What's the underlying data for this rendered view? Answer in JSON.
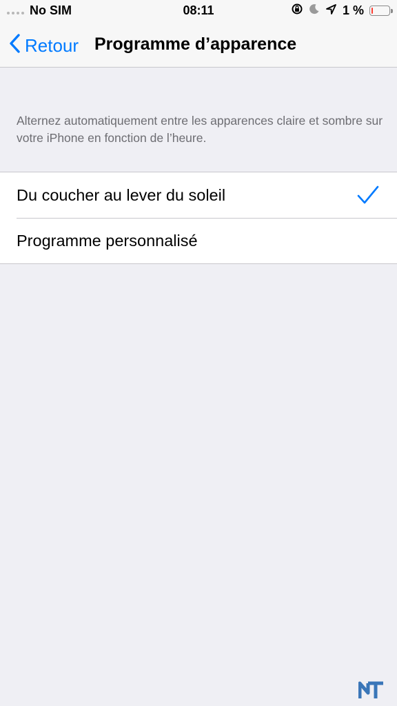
{
  "status_bar": {
    "carrier": "No SIM",
    "time": "08:11",
    "battery_percent": "1 %",
    "battery_level": 0.01,
    "icons": [
      "orientation-lock-icon",
      "moon-icon",
      "location-arrow-icon",
      "battery-icon"
    ]
  },
  "nav": {
    "back_label": "Retour",
    "title": "Programme d’apparence"
  },
  "description": "Alternez automatiquement entre les apparences claire et sombre sur votre iPhone en fonction de l’heure.",
  "options": [
    {
      "label": "Du coucher au lever du soleil",
      "selected": true
    },
    {
      "label": "Programme personnalisé",
      "selected": false
    }
  ],
  "watermark": "NT",
  "colors": {
    "accent": "#007aff",
    "background": "#efeff4",
    "separator": "#c8c7cc",
    "secondary_text": "#6d6d72"
  }
}
